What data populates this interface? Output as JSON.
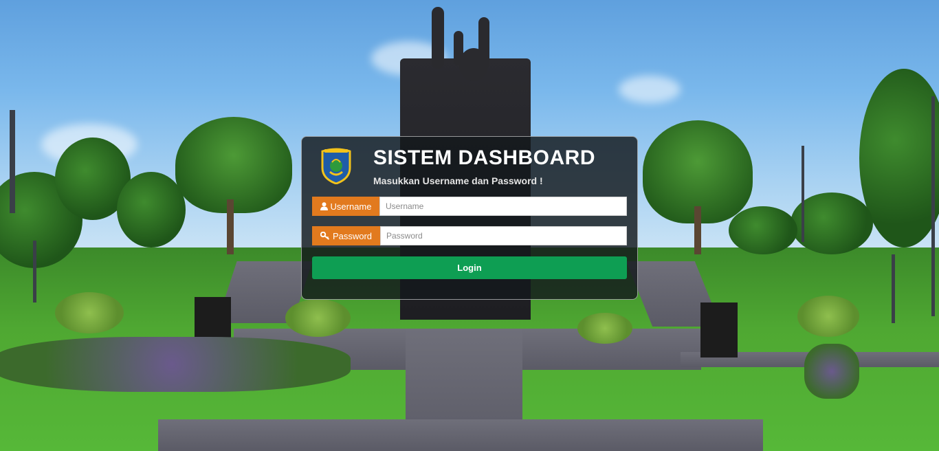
{
  "login": {
    "title": "SISTEM DASHBOARD",
    "subtitle": "Masukkan Username dan Password !",
    "logo_icon": "regional-emblem-logo",
    "username": {
      "label": "Username",
      "icon": "user-icon",
      "placeholder": "Username",
      "value": ""
    },
    "password": {
      "label": "Password",
      "icon": "key-icon",
      "placeholder": "Password",
      "value": ""
    },
    "login_button": "Login"
  },
  "colors": {
    "addon_orange": "#e27a1e",
    "login_green": "#0e9e53",
    "panel_dark": "#14181c"
  },
  "background": {
    "description_icon": "park-monument-background"
  }
}
